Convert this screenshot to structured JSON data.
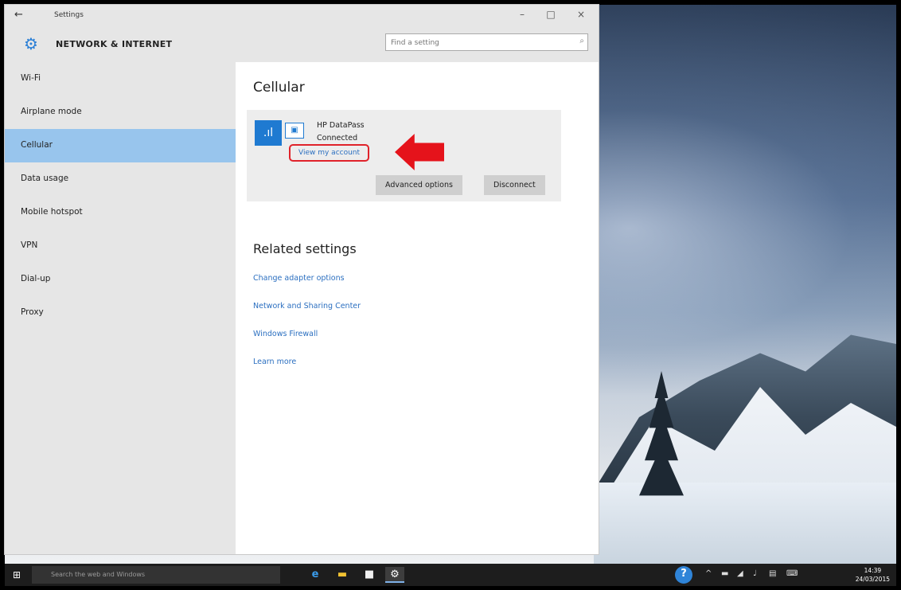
{
  "window": {
    "title": "Settings",
    "back_icon": "←",
    "minimize_icon": "–",
    "maximize_icon": "□",
    "close_icon": "×"
  },
  "header": {
    "section_title": "NETWORK & INTERNET",
    "gear_icon": "⚙",
    "search_placeholder": "Find a setting",
    "search_icon": "⌕"
  },
  "sidebar": {
    "items": [
      {
        "label": "Wi-Fi"
      },
      {
        "label": "Airplane mode"
      },
      {
        "label": "Cellular"
      },
      {
        "label": "Data usage"
      },
      {
        "label": "Mobile hotspot"
      },
      {
        "label": "VPN"
      },
      {
        "label": "Dial-up"
      },
      {
        "label": "Proxy"
      }
    ],
    "active_index": 2
  },
  "content": {
    "heading": "Cellular",
    "connection": {
      "signal_icon": ".ıl",
      "device_icon": "▣",
      "device_name": "HP DataPass",
      "status": "Connected",
      "view_account": "View my account",
      "advanced_button": "Advanced options",
      "disconnect_button": "Disconnect"
    },
    "related_heading": "Related settings",
    "links": [
      "Change adapter options",
      "Network and Sharing Center",
      "Windows Firewall",
      "Learn more"
    ]
  },
  "annotation": {
    "arrow_color": "#e5131b",
    "highlight_color": "#e0222a"
  },
  "taskbar": {
    "start_icon": "⊞",
    "search_text": "Search the web and Windows",
    "apps": [
      {
        "name": "edge",
        "glyph": "e",
        "color": "#3a9bea"
      },
      {
        "name": "file-explorer",
        "glyph": "▬",
        "color": "#f1c232"
      },
      {
        "name": "store",
        "glyph": "■",
        "color": "#f0f0f0"
      },
      {
        "name": "settings",
        "glyph": "⚙",
        "color": "#ffffff"
      }
    ],
    "help_icon": "?",
    "time": "14:39",
    "date": "24/03/2015"
  },
  "colors": {
    "accent": "#1f7ad1",
    "link": "#2b6fc0",
    "selected_nav": "#98c5ed",
    "sidebar_bg": "#e6e6e6"
  }
}
